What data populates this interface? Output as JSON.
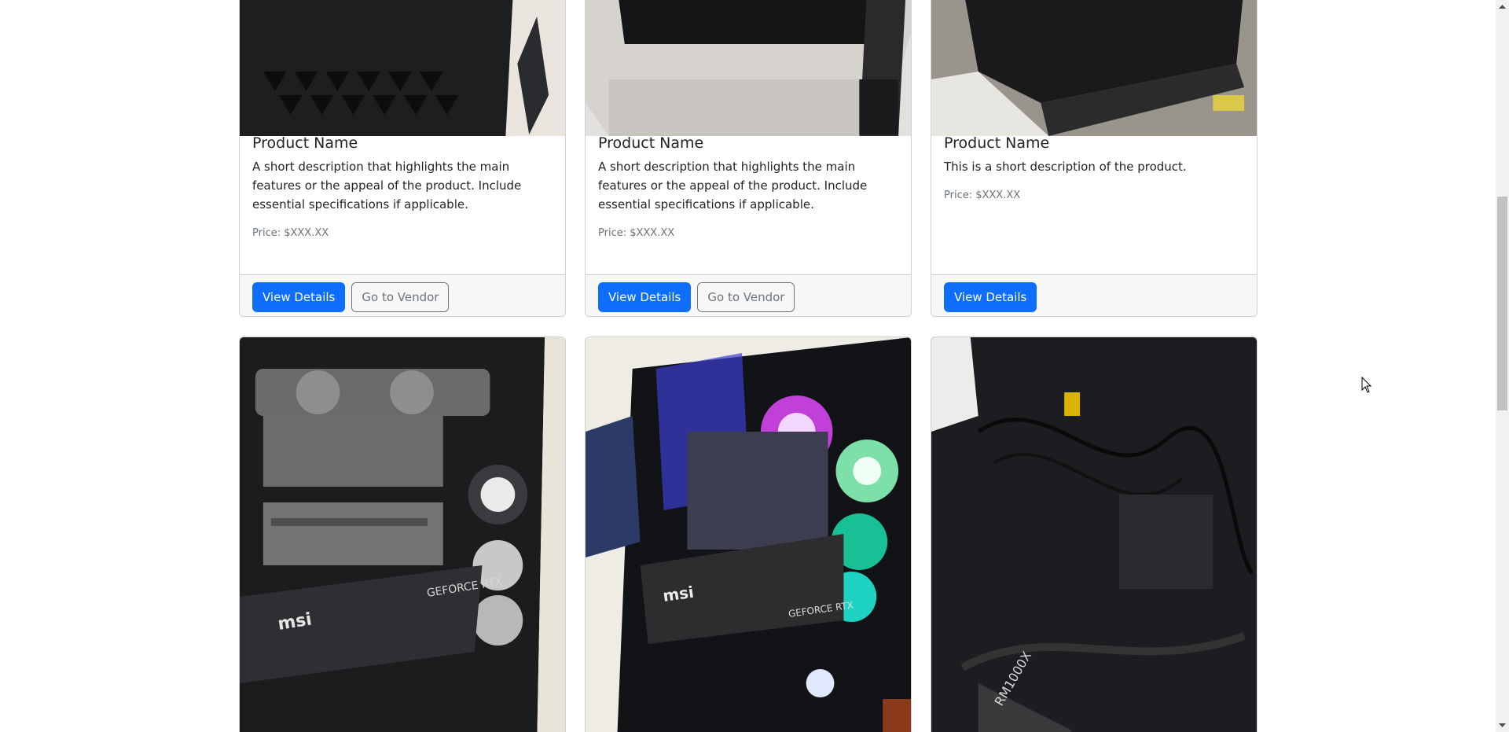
{
  "products_row1": [
    {
      "title": "Product Name",
      "description": "A short description that highlights the main features or the appeal of the product. Include essential specifications if applicable.",
      "price": "Price: $XXX.XX",
      "details_label": "View Details",
      "vendor_label": "Go to Vendor"
    },
    {
      "title": "Product Name",
      "description": "A short description that highlights the main features or the appeal of the product. Include essential specifications if applicable.",
      "price": "Price: $XXX.XX",
      "details_label": "View Details",
      "vendor_label": "Go to Vendor"
    },
    {
      "title": "Product Name",
      "description": "This is a short description of the product.",
      "price": "Price: $XXX.XX",
      "details_label": "View Details"
    }
  ],
  "products_row2": [
    {
      "image": "pc-case-photo"
    },
    {
      "image": "pc-case-rgb-photo"
    },
    {
      "image": "pc-case-cables-photo"
    }
  ],
  "colors": {
    "primary": "#0d6efd",
    "secondary": "#6c757d"
  }
}
